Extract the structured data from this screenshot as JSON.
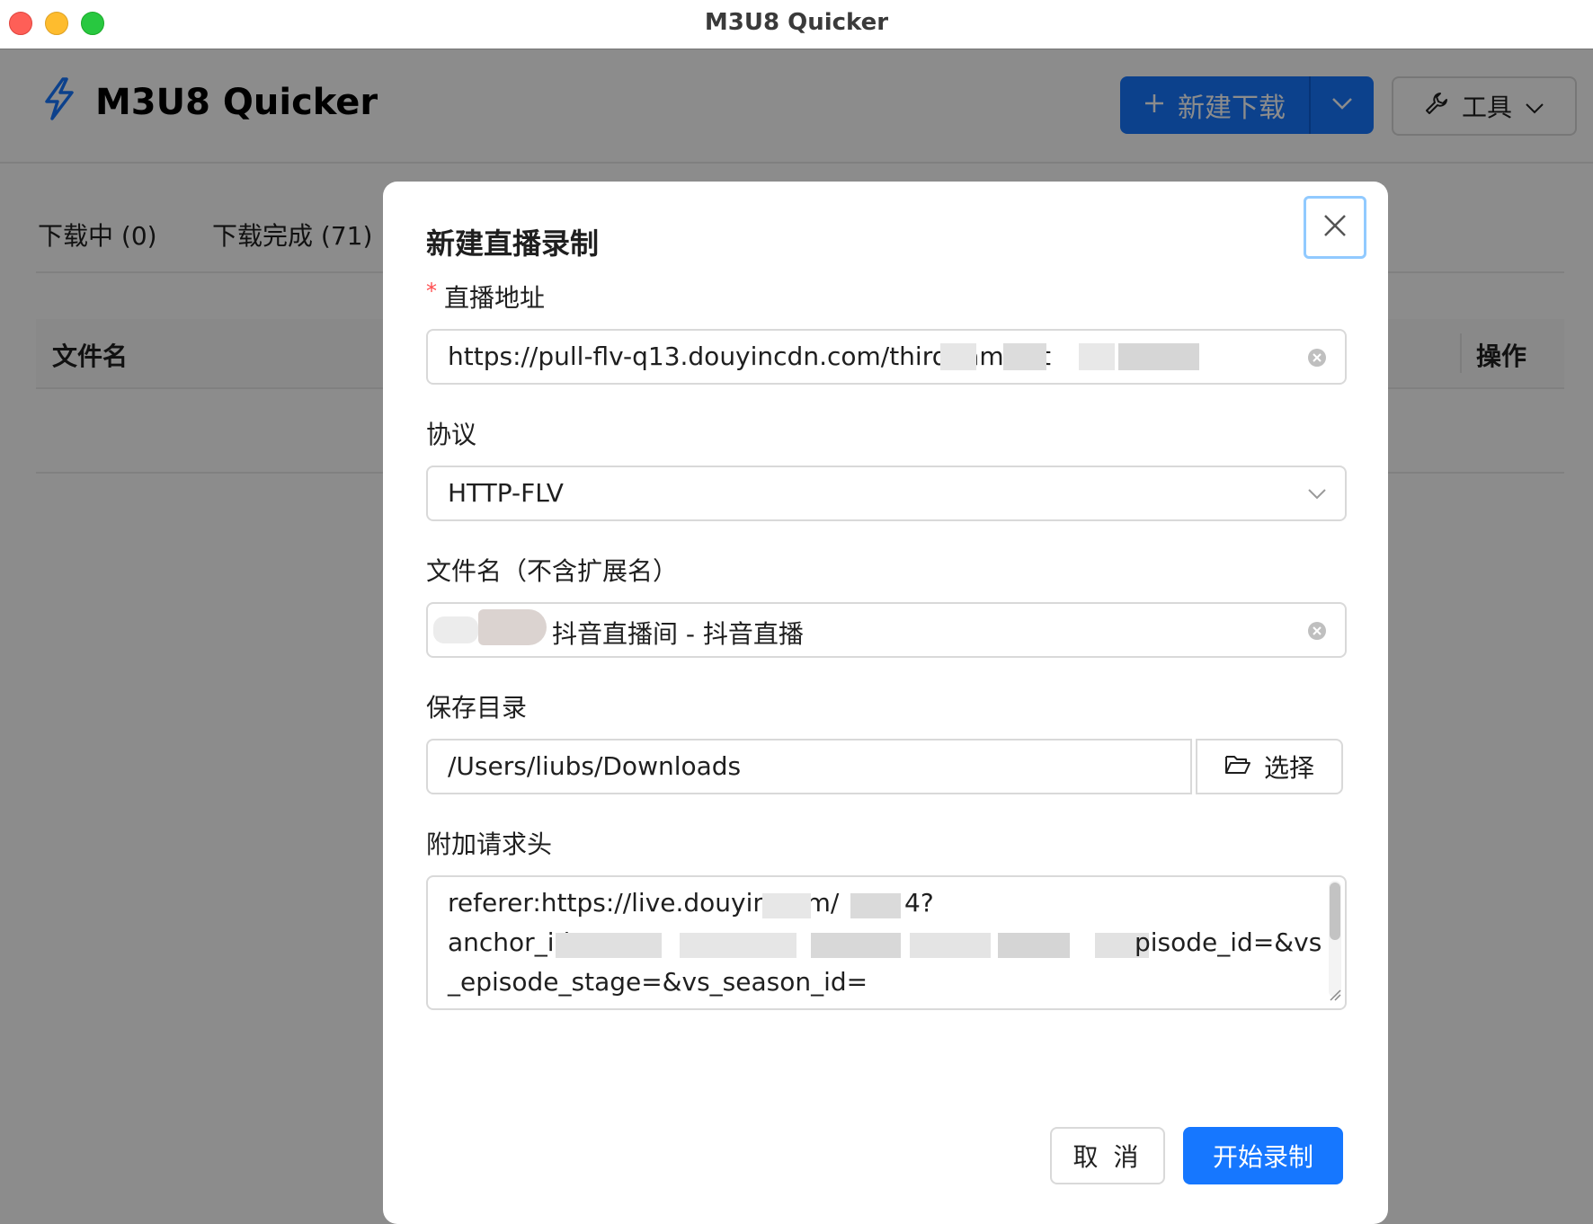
{
  "window": {
    "title": "M3U8 Quicker"
  },
  "app": {
    "name": "M3U8 Quicker",
    "new_download_label": "新建下载",
    "tools_label": "工具"
  },
  "tabs": [
    {
      "label": "下载中 (0)"
    },
    {
      "label": "下载完成 (71)"
    }
  ],
  "table": {
    "columns": {
      "name": "文件名",
      "action": "操作"
    }
  },
  "dialog": {
    "title": "新建直播录制",
    "live_url": {
      "required_mark": "*",
      "label": "直播地址",
      "value": "https://pull-flv-q13.douyincdn.com/thirdgame/st"
    },
    "protocol": {
      "label": "协议",
      "value": "HTTP-FLV"
    },
    "filename": {
      "label": "文件名（不含扩展名）",
      "value": "抖音直播间 - 抖音直播"
    },
    "save_dir": {
      "label": "保存目录",
      "value": "/Users/liubs/Downloads",
      "browse_label": "选择"
    },
    "headers": {
      "label": "附加请求头",
      "line1": "referer:https://live.douyin.com/",
      "line1_tail": "4?",
      "line2": "anchor_id=",
      "line2_tail": "pisode_id=&vs",
      "line3": "_episode_stage=&vs_season_id="
    },
    "cancel_label": "取 消",
    "submit_label": "开始录制"
  },
  "colors": {
    "primary": "#1677ff",
    "overlay": "rgba(0,0,0,0.45)",
    "required": "#ff4d4f"
  },
  "icons": [
    "lightning-icon",
    "plus-icon",
    "chevron-down-icon",
    "wrench-icon",
    "close-icon",
    "clear-icon",
    "folder-open-icon"
  ]
}
